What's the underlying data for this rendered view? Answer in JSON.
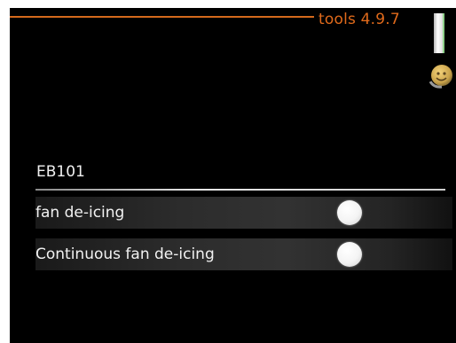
{
  "header": {
    "menu_path": "tools 4.9.7",
    "accent_color": "#e06a1b"
  },
  "icons": {
    "scroll_indicator": "scroll-indicator",
    "status": "smiley-icon"
  },
  "section": {
    "title": "EB101"
  },
  "options": [
    {
      "label": "fan de-icing",
      "selected": false
    },
    {
      "label": "Continuous fan de-icing",
      "selected": false
    }
  ]
}
